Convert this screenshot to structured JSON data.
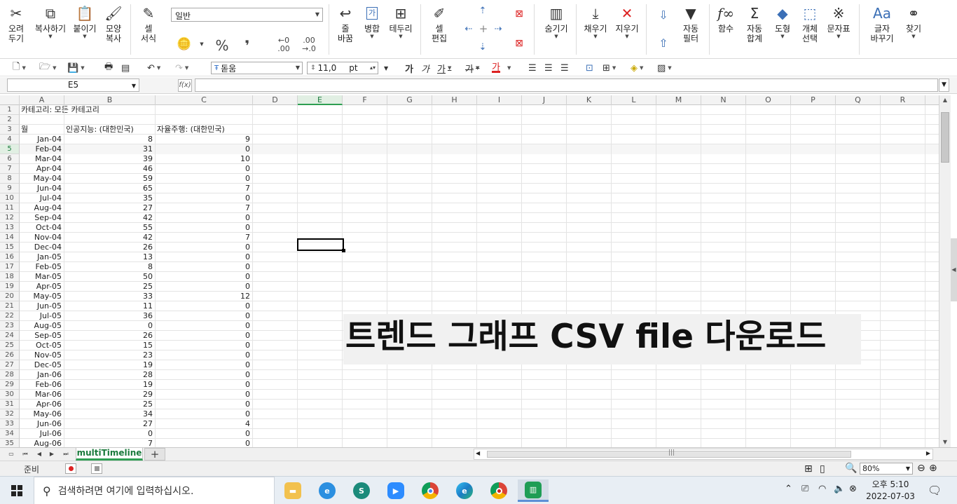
{
  "ribbon": {
    "cut": "오려\n두기",
    "copy": "복사하기",
    "paste": "붙이기",
    "format_painter": "모양\n복사",
    "cell_format": "셀\n서식",
    "number_format": "일반",
    "percent_symbol": "%",
    "comma_symbol": "❜",
    "inc_decimal": "←0\n.00",
    "dec_decimal": ".00\n→.0",
    "wrap": "줄\n바꿈",
    "merge": "병합",
    "border": "테두리",
    "cell_edit": "셀\n편집",
    "hide": "숨기기",
    "fill": "채우기",
    "clear": "지우기",
    "autofilter": "자동\n필터",
    "functions": "함수",
    "autosum": "자동\n합계",
    "shapes": "도형",
    "object_select": "개체\n선택",
    "symbols": "문자표",
    "replace": "글자\n바꾸기",
    "find": "찾기"
  },
  "toolbar2": {
    "font_name": "돋움",
    "font_size": "11,0",
    "font_unit": "pt",
    "bold": "가",
    "italic": "가",
    "underline": "가",
    "strike": "가",
    "font_color": "가"
  },
  "formula_bar": {
    "cell_ref": "E5",
    "fx_label": "f(x)",
    "content": ""
  },
  "columns": [
    "A",
    "B",
    "C",
    "D",
    "E",
    "F",
    "G",
    "H",
    "I",
    "J",
    "K",
    "L",
    "M",
    "N",
    "O",
    "P",
    "Q",
    "R"
  ],
  "active_column": "E",
  "active_row": 5,
  "sheet": {
    "title_cell": "카테고리: 모든 카테고리",
    "header_month": "월",
    "header_ai": "인공지능: (대한민국)",
    "header_auto": "자율주행: (대한민국)",
    "data": [
      {
        "row": 4,
        "m": "Jan-04",
        "a": "8",
        "b": "9"
      },
      {
        "row": 5,
        "m": "Feb-04",
        "a": "31",
        "b": "0"
      },
      {
        "row": 6,
        "m": "Mar-04",
        "a": "39",
        "b": "10"
      },
      {
        "row": 7,
        "m": "Apr-04",
        "a": "46",
        "b": "0"
      },
      {
        "row": 8,
        "m": "May-04",
        "a": "59",
        "b": "0"
      },
      {
        "row": 9,
        "m": "Jun-04",
        "a": "65",
        "b": "7"
      },
      {
        "row": 10,
        "m": "Jul-04",
        "a": "35",
        "b": "0"
      },
      {
        "row": 11,
        "m": "Aug-04",
        "a": "27",
        "b": "7"
      },
      {
        "row": 12,
        "m": "Sep-04",
        "a": "42",
        "b": "0"
      },
      {
        "row": 13,
        "m": "Oct-04",
        "a": "55",
        "b": "0"
      },
      {
        "row": 14,
        "m": "Nov-04",
        "a": "42",
        "b": "7"
      },
      {
        "row": 15,
        "m": "Dec-04",
        "a": "26",
        "b": "0"
      },
      {
        "row": 16,
        "m": "Jan-05",
        "a": "13",
        "b": "0"
      },
      {
        "row": 17,
        "m": "Feb-05",
        "a": "8",
        "b": "0"
      },
      {
        "row": 18,
        "m": "Mar-05",
        "a": "50",
        "b": "0"
      },
      {
        "row": 19,
        "m": "Apr-05",
        "a": "25",
        "b": "0"
      },
      {
        "row": 20,
        "m": "May-05",
        "a": "33",
        "b": "12"
      },
      {
        "row": 21,
        "m": "Jun-05",
        "a": "11",
        "b": "0"
      },
      {
        "row": 22,
        "m": "Jul-05",
        "a": "36",
        "b": "0"
      },
      {
        "row": 23,
        "m": "Aug-05",
        "a": "0",
        "b": "0"
      },
      {
        "row": 24,
        "m": "Sep-05",
        "a": "26",
        "b": "0"
      },
      {
        "row": 25,
        "m": "Oct-05",
        "a": "15",
        "b": "0"
      },
      {
        "row": 26,
        "m": "Nov-05",
        "a": "23",
        "b": "0"
      },
      {
        "row": 27,
        "m": "Dec-05",
        "a": "19",
        "b": "0"
      },
      {
        "row": 28,
        "m": "Jan-06",
        "a": "28",
        "b": "0"
      },
      {
        "row": 29,
        "m": "Feb-06",
        "a": "19",
        "b": "0"
      },
      {
        "row": 30,
        "m": "Mar-06",
        "a": "29",
        "b": "0"
      },
      {
        "row": 31,
        "m": "Apr-06",
        "a": "25",
        "b": "0"
      },
      {
        "row": 32,
        "m": "May-06",
        "a": "34",
        "b": "0"
      },
      {
        "row": 33,
        "m": "Jun-06",
        "a": "27",
        "b": "4"
      },
      {
        "row": 34,
        "m": "Jul-06",
        "a": "0",
        "b": "0"
      },
      {
        "row": 35,
        "m": "Aug-06",
        "a": "7",
        "b": "0"
      }
    ]
  },
  "overlay_text": "트렌드 그래프 CSV file 다운로드",
  "sheet_tab": "multiTimeline",
  "add_sheet": "+",
  "status": {
    "ready": "준비",
    "zoom": "80%"
  },
  "taskbar": {
    "search_placeholder": "검색하려면 여기에 입력하십시오.",
    "time": "오후 5:10",
    "date": "2022-07-03"
  }
}
